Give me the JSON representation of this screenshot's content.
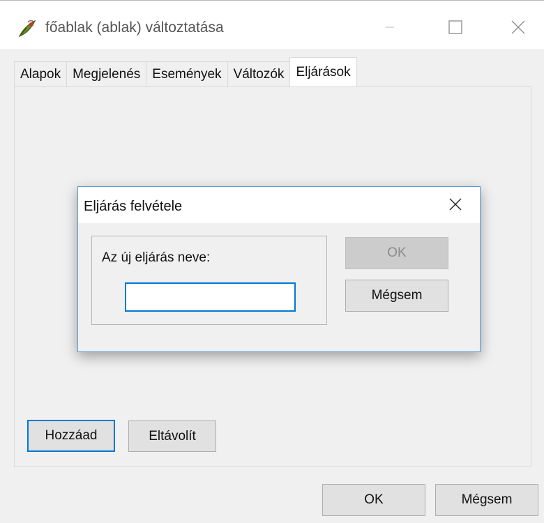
{
  "window": {
    "title": "főablak (ablak) változtatása",
    "icons": {
      "app": "feather-pen-icon",
      "minimize": "minimize-icon",
      "maximize": "maximize-icon",
      "close": "close-icon"
    }
  },
  "tabs": [
    {
      "label": "Alapok",
      "active": false
    },
    {
      "label": "Megjelenés",
      "active": false
    },
    {
      "label": "Események",
      "active": false
    },
    {
      "label": "Változók",
      "active": false
    },
    {
      "label": "Eljárások",
      "active": true
    }
  ],
  "panel": {
    "add_label": "Hozzáad",
    "remove_label": "Eltávolít"
  },
  "footer": {
    "ok_label": "OK",
    "cancel_label": "Mégsem"
  },
  "dialog": {
    "title": "Eljárás felvétele",
    "group_label": "Az új eljárás neve:",
    "name_value": "",
    "ok_label": "OK",
    "ok_disabled": true,
    "cancel_label": "Mégsem"
  },
  "colors": {
    "accent": "#0078d7",
    "dialog_border": "#5a9bd8",
    "window_bg": "#f0f0f0"
  }
}
